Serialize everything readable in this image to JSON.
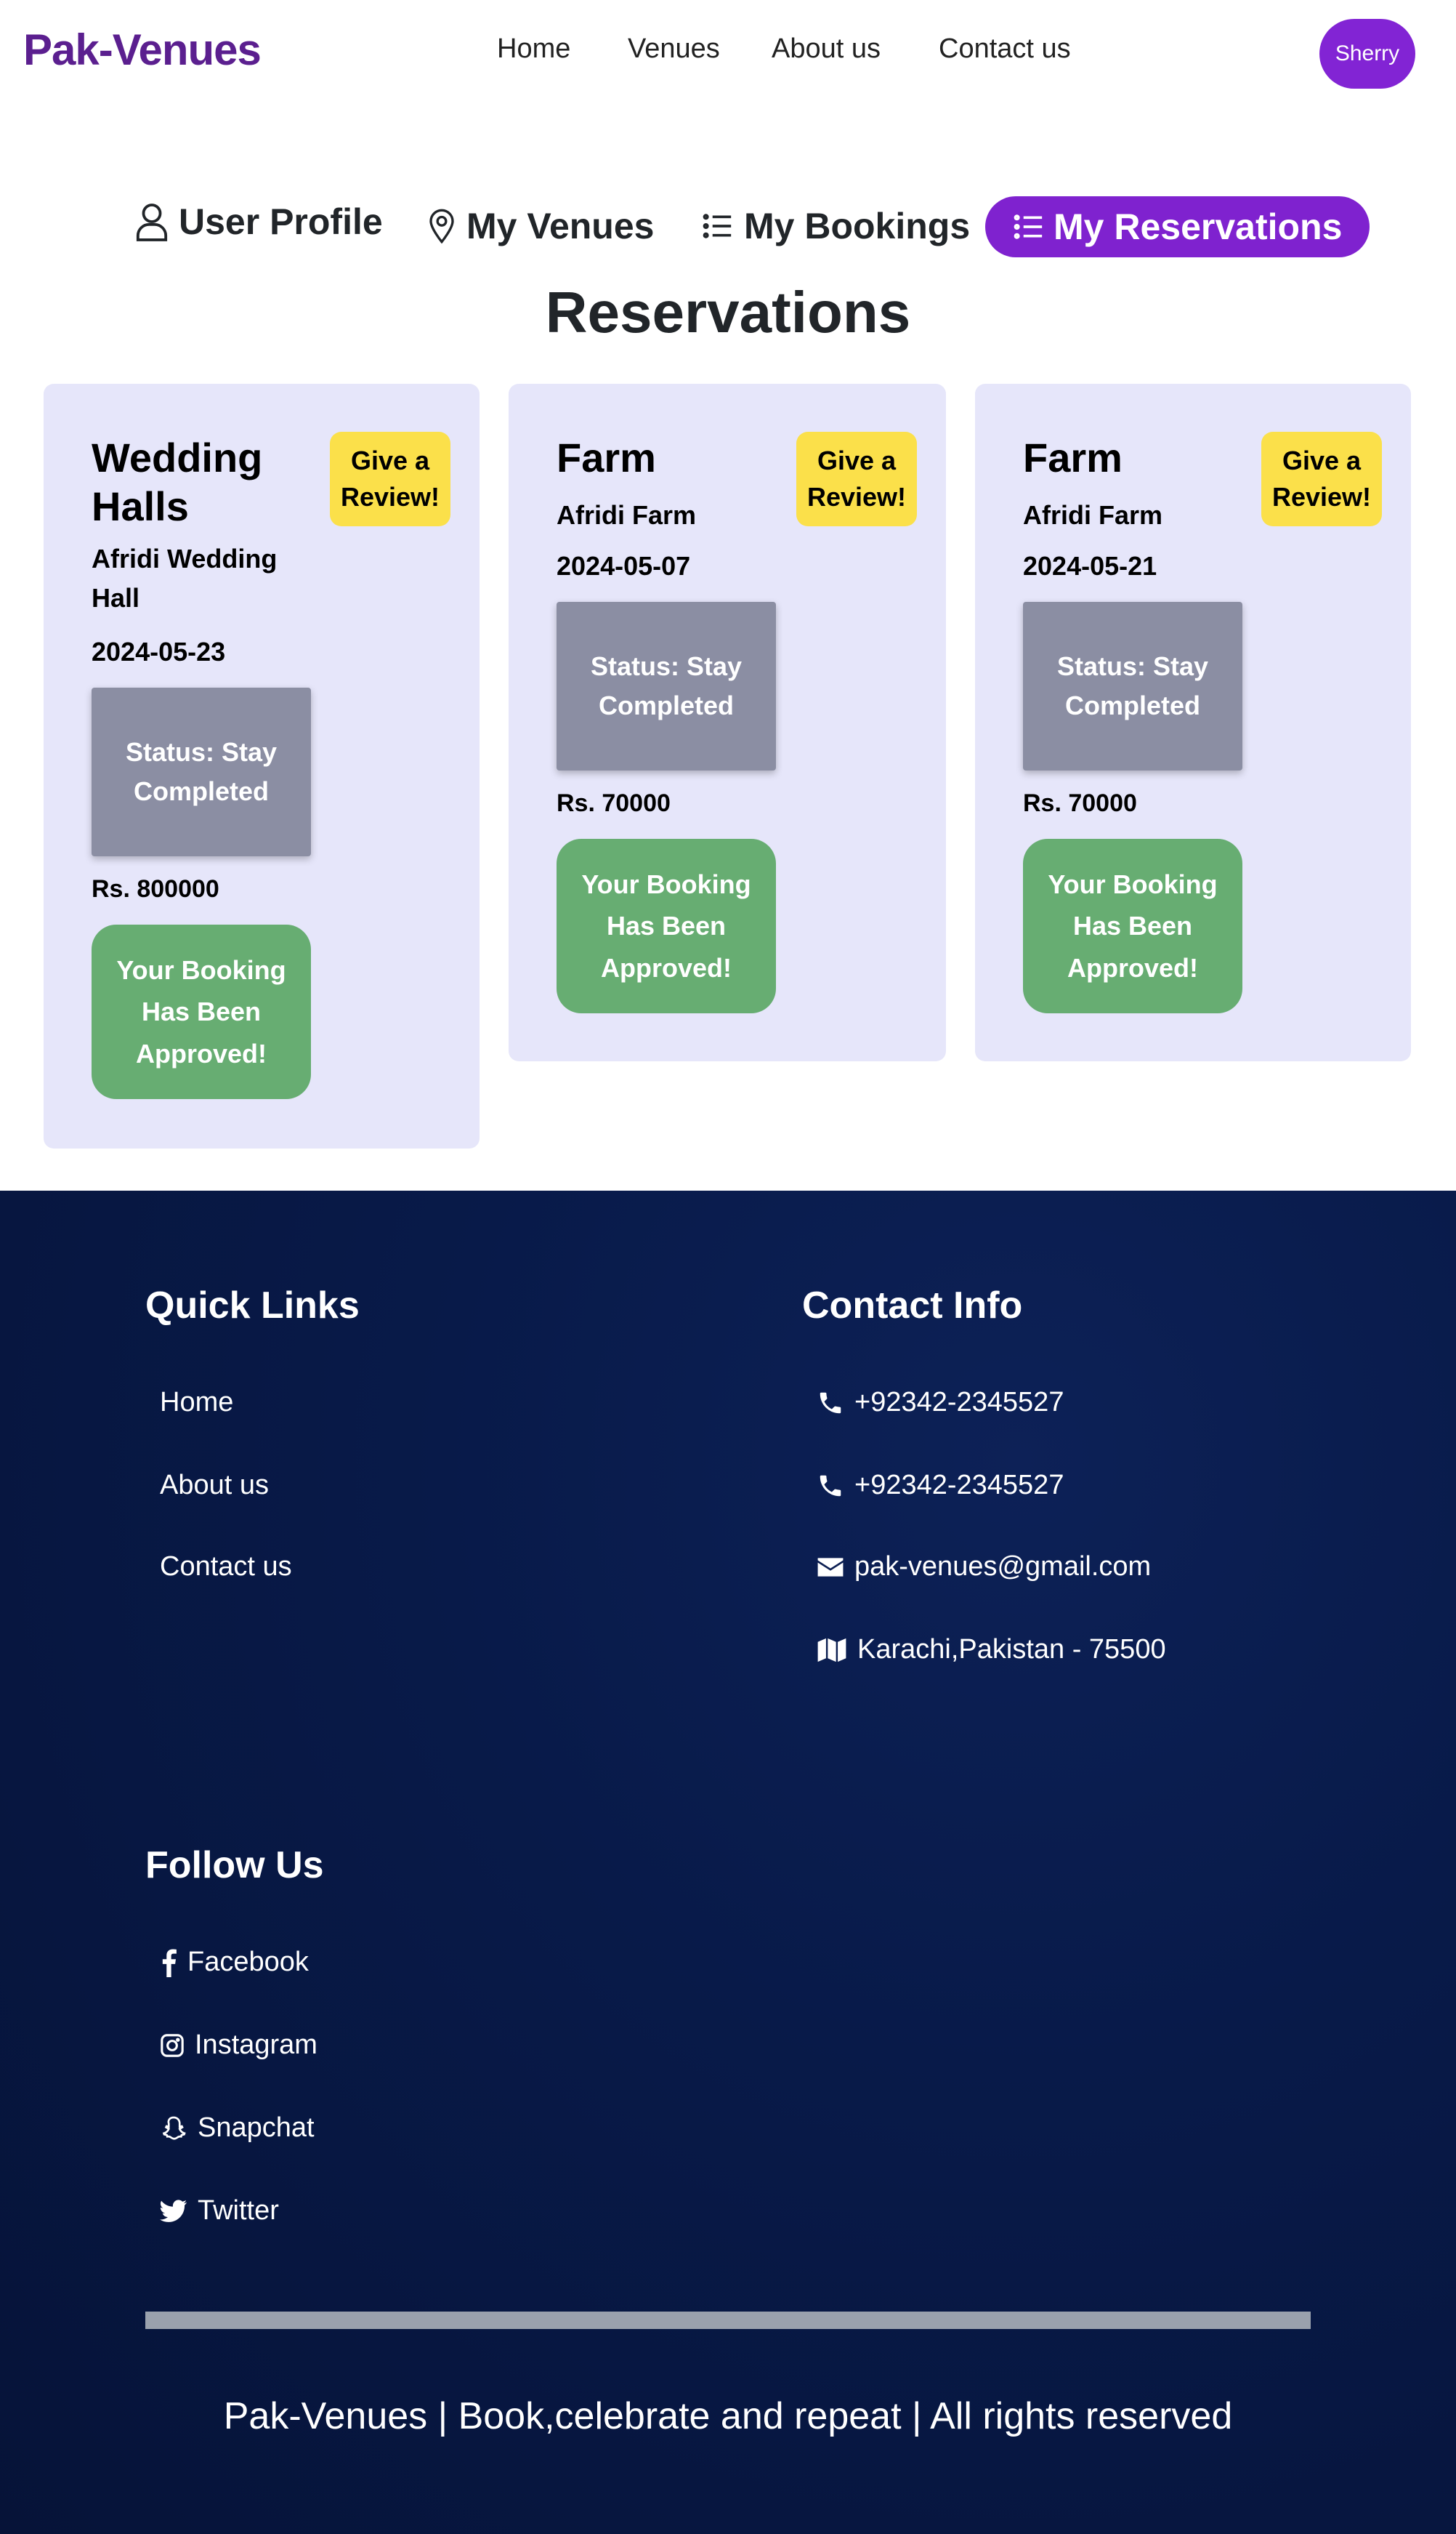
{
  "nav": {
    "brand": "Pak-Venues",
    "links": [
      "Home",
      "Venues",
      "About us",
      "Contact us"
    ],
    "user": "Sherry"
  },
  "tabs": [
    {
      "label": "User Profile",
      "icon": "person-icon",
      "active": false
    },
    {
      "label": "My Venues",
      "icon": "location-pin-icon",
      "active": false
    },
    {
      "label": "My Bookings",
      "icon": "list-icon",
      "active": false
    },
    {
      "label": "My Reservations",
      "icon": "list-icon",
      "active": true
    }
  ],
  "page_title": "Reservations",
  "reservations": [
    {
      "type_line1": "Wedding",
      "type_line2": "Halls",
      "venue_line1": "Afridi Wedding",
      "venue_line2": "Hall",
      "date": "2024-05-23",
      "status_line1": "Status: Stay",
      "status_line2": "Completed",
      "price": "Rs. 800000",
      "review_line1": "Give a",
      "review_line2": "Review!",
      "approved_line1": "Your Booking",
      "approved_line2": "Has Been",
      "approved_line3": "Approved!"
    },
    {
      "type_line1": "Farm",
      "venue_line1": "Afridi Farm",
      "date": "2024-05-07",
      "status_line1": "Status: Stay",
      "status_line2": "Completed",
      "price": "Rs. 70000",
      "review_line1": "Give a",
      "review_line2": "Review!",
      "approved_line1": "Your Booking",
      "approved_line2": "Has Been",
      "approved_line3": "Approved!"
    },
    {
      "type_line1": "Farm",
      "venue_line1": "Afridi Farm",
      "date": "2024-05-21",
      "status_line1": "Status: Stay",
      "status_line2": "Completed",
      "price": "Rs. 70000",
      "review_line1": "Give a",
      "review_line2": "Review!",
      "approved_line1": "Your Booking",
      "approved_line2": "Has Been",
      "approved_line3": "Approved!"
    }
  ],
  "footer": {
    "quick_links_title": "Quick Links",
    "quick_links": [
      "Home",
      "About us",
      "Contact us"
    ],
    "contact_title": "Contact Info",
    "contacts": [
      {
        "icon": "phone-icon",
        "text": "+92342-2345527"
      },
      {
        "icon": "phone-icon",
        "text": "+92342-2345527"
      },
      {
        "icon": "envelope-icon",
        "text": "pak-venues@gmail.com"
      },
      {
        "icon": "map-icon",
        "text": "Karachi,Pakistan - 75500"
      }
    ],
    "follow_title": "Follow Us",
    "social": [
      {
        "icon": "facebook-icon",
        "text": "Facebook"
      },
      {
        "icon": "instagram-icon",
        "text": "Instagram"
      },
      {
        "icon": "snapchat-icon",
        "text": "Snapchat"
      },
      {
        "icon": "twitter-icon",
        "text": "Twitter"
      }
    ],
    "copyright": "Pak-Venues | Book,celebrate and repeat | All rights reserved"
  },
  "colors": {
    "brand": "#5b1f8f",
    "accent": "#7f22cf",
    "card_bg": "#e6e6fa",
    "review_yellow": "#fbe04a",
    "status_gray": "#8b8ea3",
    "approved_green": "#67ad72",
    "footer_navy": "#081a49"
  }
}
